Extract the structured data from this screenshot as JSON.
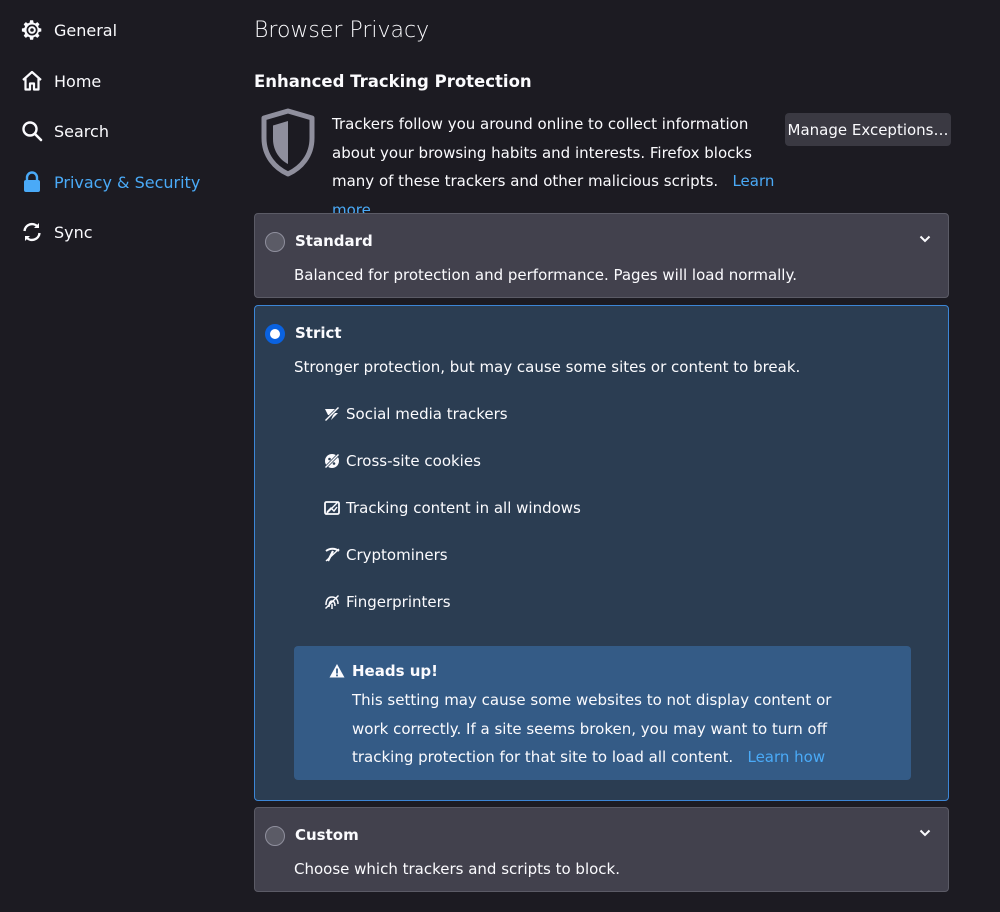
{
  "sidebar": {
    "items": [
      {
        "label": "General",
        "icon": "gear-icon"
      },
      {
        "label": "Home",
        "icon": "home-icon"
      },
      {
        "label": "Search",
        "icon": "search-icon"
      },
      {
        "label": "Privacy & Security",
        "icon": "lock-icon",
        "selected": true
      },
      {
        "label": "Sync",
        "icon": "sync-icon"
      }
    ]
  },
  "main": {
    "page_title": "Browser Privacy",
    "section_title": "Enhanced Tracking Protection",
    "description": "Trackers follow you around online to collect information about your browsing habits and interests. Firefox blocks many of these trackers and other malicious scripts.",
    "learn_more": "Learn more",
    "manage_exceptions": "Manage Exceptions…",
    "options": {
      "standard": {
        "label": "Standard",
        "desc": "Balanced for protection and performance. Pages will load normally.",
        "checked": false
      },
      "strict": {
        "label": "Strict",
        "desc": "Stronger protection, but may cause some sites or content to break.",
        "checked": true,
        "trackers": [
          {
            "label": "Social media trackers",
            "icon": "social-tracker-icon"
          },
          {
            "label": "Cross-site cookies",
            "icon": "cookie-icon"
          },
          {
            "label": "Tracking content in all windows",
            "icon": "tracking-content-icon"
          },
          {
            "label": "Cryptominers",
            "icon": "cryptominer-icon"
          },
          {
            "label": "Fingerprinters",
            "icon": "fingerprinter-icon"
          }
        ],
        "warning": {
          "title": "Heads up!",
          "text": "This setting may cause some websites to not display content or work correctly. If a site seems broken, you may want to turn off tracking protection for that site to load all content.",
          "link": "Learn how"
        }
      },
      "custom": {
        "label": "Custom",
        "desc": "Choose which trackers and scripts to block.",
        "checked": false
      }
    }
  },
  "colors": {
    "background": "#1c1b22",
    "card": "#42414d",
    "selected_card": "#2b3d52",
    "accent": "#4aaaf7",
    "warning_box": "#345b86"
  }
}
